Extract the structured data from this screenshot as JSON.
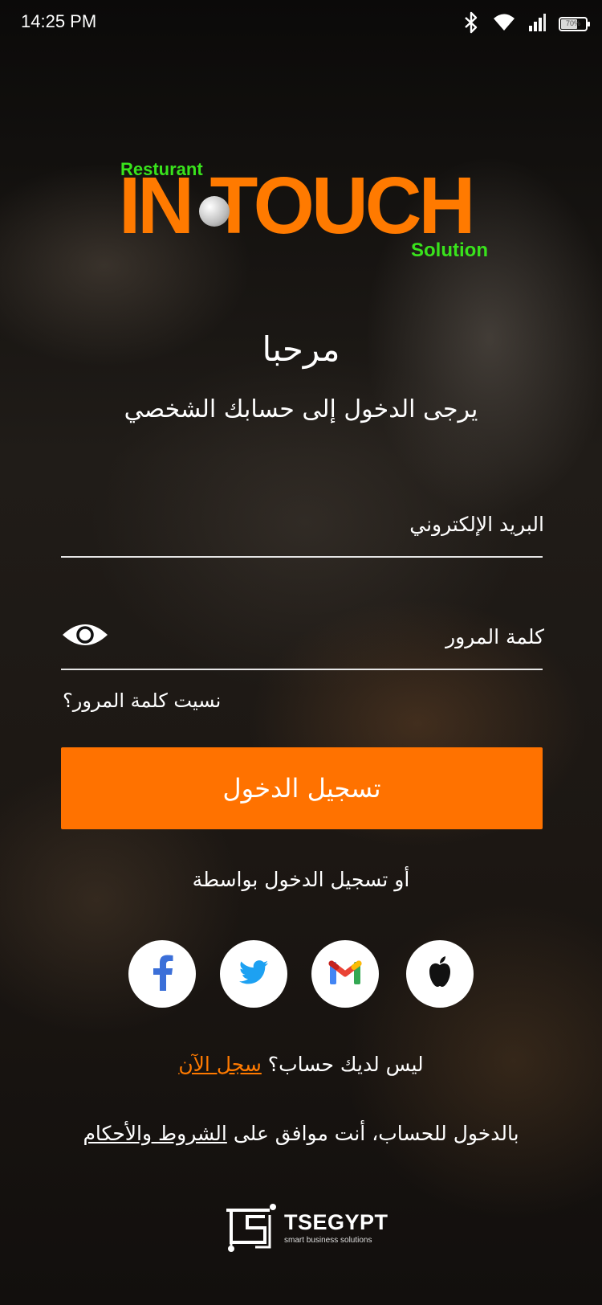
{
  "status_bar": {
    "time": "14:25 PM",
    "battery_percent": 70,
    "battery_label": "70%",
    "icons": [
      "bluetooth-icon",
      "wifi-icon",
      "signal-icon",
      "battery-icon"
    ]
  },
  "logo": {
    "top": "Resturant",
    "main": "IN TOUCH",
    "bottom": "Solution",
    "colors": {
      "orange": "#ff7a00",
      "green": "#39e31c"
    }
  },
  "welcome": "مرحبا",
  "subtitle": "يرجى الدخول إلى حسابك الشخصي",
  "form": {
    "email_placeholder": "البريد الإلكتروني",
    "password_placeholder": "كلمة المرور",
    "forgot_password": "نسيت كلمة المرور؟",
    "login_button": "تسجيل الدخول"
  },
  "social": {
    "or_label": "أو تسجيل الدخول بواسطة",
    "providers": [
      "facebook-icon",
      "twitter-icon",
      "gmail-icon",
      "apple-icon"
    ]
  },
  "register": {
    "question": "ليس لديك حساب؟",
    "link": "سجل الآن"
  },
  "terms": {
    "prefix": "بالدخول للحساب، أنت موافق على",
    "link": "الشروط والأحكام"
  },
  "footer": {
    "brand": "TSEGYPT",
    "tagline": "smart business solutions"
  },
  "colors": {
    "accent": "#ff7200",
    "text": "#ffffff"
  }
}
